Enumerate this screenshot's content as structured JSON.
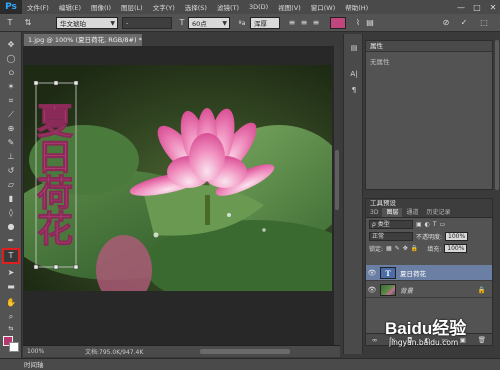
{
  "app": {
    "logo": "Ps"
  },
  "menu": [
    "文件(F)",
    "编辑(E)",
    "图像(I)",
    "图层(L)",
    "文字(Y)",
    "选择(S)",
    "滤镜(T)",
    "3D(D)",
    "视图(V)",
    "窗口(W)",
    "帮助(H)"
  ],
  "window_controls": [
    "—",
    "□",
    "✕"
  ],
  "options_bar": {
    "font_family": "华文琥珀",
    "font_style": "-",
    "font_size": "60点",
    "antialias": "浑厚",
    "text_color": "#c0467d"
  },
  "document": {
    "tab_title": "1.jpg @ 100% (夏日荷花, RGB/8#) *",
    "text_layer_content": "夏日荷花",
    "text_color": "#c0467d",
    "zoom": "100%",
    "doc_info": "文档:795.0K/947.4K"
  },
  "properties_panel": {
    "title": "属性",
    "body": "无属性"
  },
  "layers_panel": {
    "title": "工具预设",
    "tabs": [
      "3D",
      "图层",
      "通道",
      "历史记录"
    ],
    "filter_label": "ρ 类型",
    "blend_mode": "正常",
    "opacity_label": "不透明度:",
    "opacity_value": "100%",
    "lock_label": "锁定:",
    "fill_label": "填充:",
    "fill_value": "100%",
    "layers": [
      {
        "name": "夏日荷花",
        "type": "text",
        "selected": true
      },
      {
        "name": "背景",
        "type": "image",
        "selected": false
      }
    ],
    "footer_icons": [
      "∞",
      "fx",
      "◘",
      "◐",
      "▭",
      "▣",
      "🗑"
    ]
  },
  "bottom_bar": {
    "tab": "时间轴"
  },
  "watermark": {
    "brand": "Baidu经验",
    "url": "jingyan.baidu.com"
  }
}
